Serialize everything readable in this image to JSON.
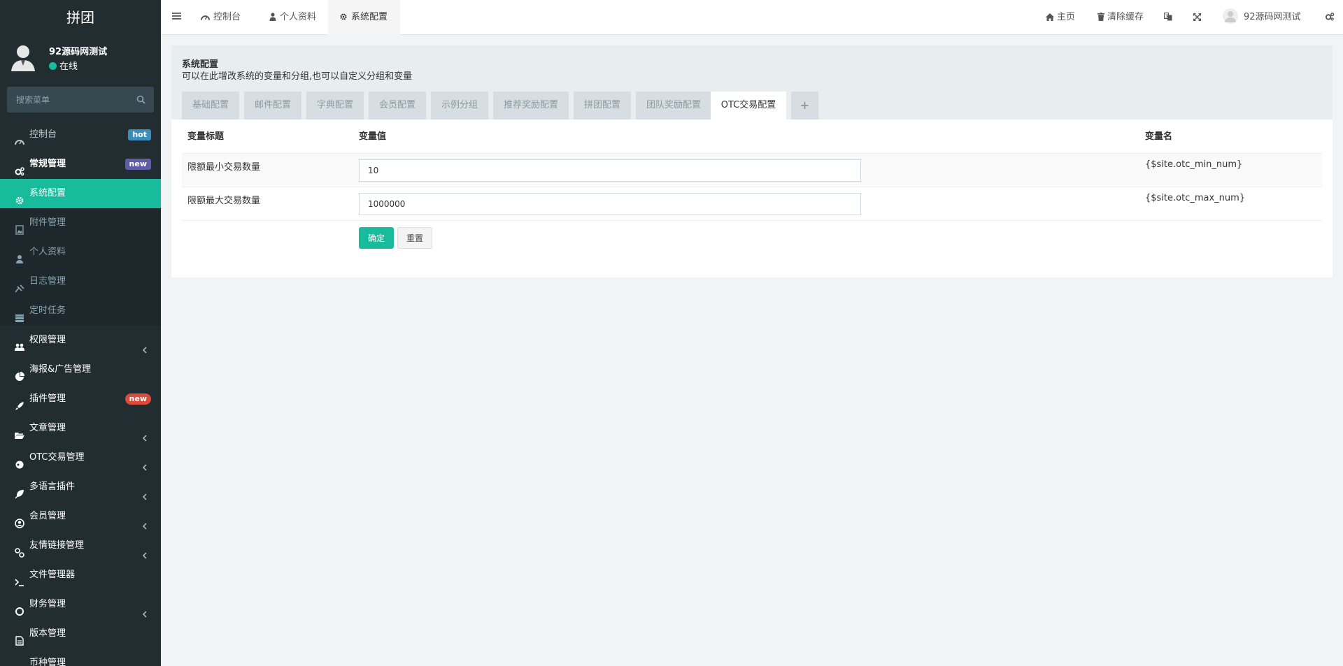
{
  "sidebar": {
    "logo": "拼团",
    "user": {
      "name": "92源码网测试",
      "status": "在线"
    },
    "search_placeholder": "搜索菜单",
    "items": [
      {
        "label": "控制台",
        "icon": "dashboard-icon",
        "badge": "hot"
      },
      {
        "label": "常规管理",
        "icon": "cogs-icon",
        "badge": "new"
      },
      {
        "label": "系统配置",
        "icon": "gear-icon",
        "state": "active"
      },
      {
        "label": "附件管理",
        "icon": "file-image-icon"
      },
      {
        "label": "个人资料",
        "icon": "user-icon"
      },
      {
        "label": "日志管理",
        "icon": "log-icon"
      },
      {
        "label": "定时任务",
        "icon": "tasks-icon"
      },
      {
        "label": "权限管理",
        "icon": "group-icon"
      },
      {
        "label": "海报&广告管理",
        "icon": "pie-chart-icon"
      },
      {
        "label": "插件管理",
        "icon": "rocket-icon",
        "badge": "new"
      },
      {
        "label": "文章管理",
        "icon": "folder-open-icon"
      },
      {
        "label": "OTC交易管理",
        "icon": "circle-icon"
      },
      {
        "label": "多语言插件",
        "icon": "leaf-icon"
      },
      {
        "label": "会员管理",
        "icon": "user-circle-icon"
      },
      {
        "label": "友情链接管理",
        "icon": "link-icon"
      },
      {
        "label": "文件管理器",
        "icon": "terminal-icon"
      },
      {
        "label": "财务管理",
        "icon": "circle-outline-icon"
      },
      {
        "label": "版本管理",
        "icon": "file-text-icon"
      },
      {
        "label": "币种管理",
        "icon": "circle-outline-icon"
      }
    ]
  },
  "topbar": {
    "tabs": [
      {
        "label": "控制台",
        "icon": "dashboard-icon"
      },
      {
        "label": "个人资料",
        "icon": "user-icon"
      },
      {
        "label": "系统配置",
        "icon": "gear-icon",
        "state": "active"
      }
    ],
    "home_label": "主页",
    "clear_cache_label": "清除缓存",
    "user_name": "92源码网测试"
  },
  "panel": {
    "title": "系统配置",
    "subtitle": "可以在此增改系统的变量和分组,也可以自定义分组和变量",
    "tabs": [
      "基础配置",
      "邮件配置",
      "字典配置",
      "会员配置",
      "示例分组",
      "推荐奖励配置",
      "拼团配置",
      "团队奖励配置",
      "OTC交易配置",
      "+"
    ],
    "active_tab": "OTC交易配置",
    "table": {
      "headers": [
        "变量标题",
        "变量值",
        "变量名"
      ],
      "rows": [
        {
          "title": "限额最小交易数量",
          "value": "10",
          "name": "{$site.otc_min_num}"
        },
        {
          "title": "限额最大交易数量",
          "value": "1000000",
          "name": "{$site.otc_max_num}"
        }
      ]
    },
    "submit_label": "确定",
    "reset_label": "重置"
  },
  "colors": {
    "accent": "#18bc9c",
    "sidebar_bg": "#222d32",
    "badge_hot": "#3c8dbc",
    "badge_new": "#605ca8",
    "badge_new_red": "#dd4b39"
  }
}
